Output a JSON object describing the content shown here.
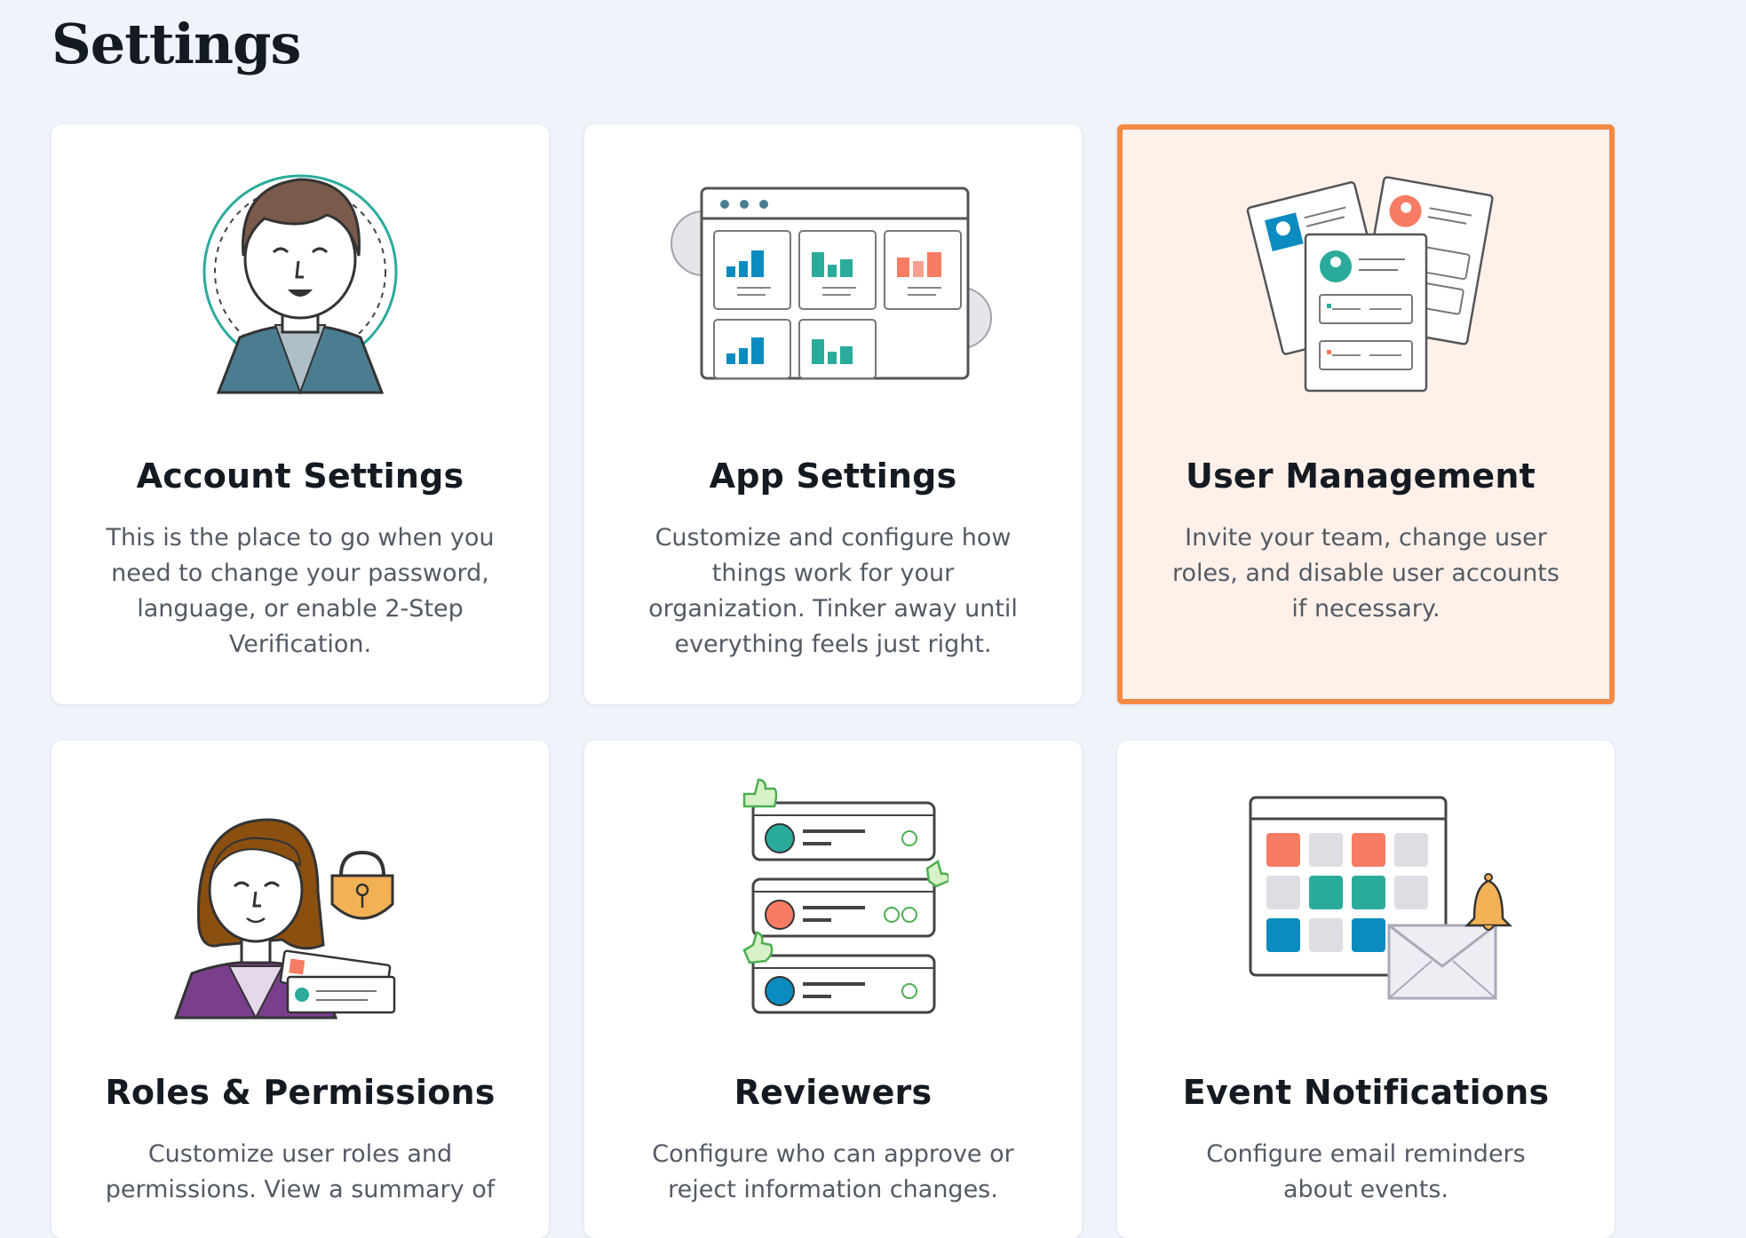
{
  "page": {
    "title": "Settings"
  },
  "cards": [
    {
      "title": "Account Settings",
      "description": "This is the place to go when you need to change your password, language, or enable 2-Step Verification.",
      "icon": "user-avatar-illustration"
    },
    {
      "title": "App Settings",
      "description": "Customize and configure how things work for your organization. Tinker away until everything feels just right.",
      "icon": "dashboard-gears-illustration"
    },
    {
      "title": "User Management",
      "description": "Invite your team, change user roles, and disable user accounts if necessary.",
      "icon": "user-cards-illustration",
      "selected": true
    },
    {
      "title": "Roles & Permissions",
      "description": "Customize user roles and permissions. View a summary of",
      "icon": "user-lock-illustration"
    },
    {
      "title": "Reviewers",
      "description": "Configure who can approve or reject information changes.",
      "icon": "reviewer-list-illustration"
    },
    {
      "title": "Event Notifications",
      "description": "Configure email reminders about events.",
      "icon": "calendar-bell-illustration"
    }
  ],
  "colors": {
    "background": "#eff3fa",
    "selected_border": "#f58a42",
    "selected_background": "#fff1ea",
    "teal": "#2aab9b",
    "blue": "#0b8bc0",
    "coral": "#f87b64"
  }
}
